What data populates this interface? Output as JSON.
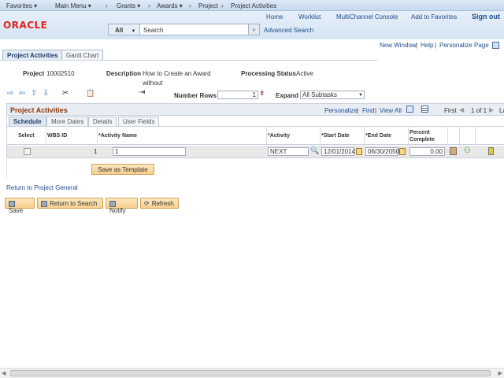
{
  "topnav": {
    "favorites": "Favorites ▾",
    "main_menu": "Main Menu ▾",
    "grants": "Grants ▾",
    "awards": "Awards ▾",
    "project": "Project",
    "project_activities": "Project Activities",
    "sep": "›"
  },
  "header": {
    "logo": "ORACLE",
    "links": [
      "Home",
      "Worklist",
      "MultiChannel Console",
      "Add to Favorites",
      "Sign out"
    ],
    "search_scope": "All",
    "search_placeholder": "Search",
    "advanced_search": "Advanced Search"
  },
  "pagelinks": {
    "new_window": "New Window",
    "help": "Help",
    "personalize_page": "Personalize Page"
  },
  "tabs": [
    "Project Activities",
    "Gantt Chart"
  ],
  "info": {
    "project_label": "Project",
    "project_value": "10002510",
    "description_label": "Description",
    "description_line1": "How to Create an Award",
    "description_line2": "without",
    "status_label": "Processing Status",
    "status_value": "Active"
  },
  "toolbar": {
    "number_rows_label": "Number Rows",
    "number_rows_value": "1",
    "expand_label": "Expand",
    "expand_value": "All Subtasks"
  },
  "grid": {
    "title": "Project Activities",
    "nav": {
      "personalize": "Personalize",
      "find": "Find",
      "view_all": "View All",
      "first": "First",
      "range": "1 of 1",
      "last": "La"
    },
    "tabs": [
      "Schedule",
      "More Dates",
      "Details",
      "User Fields"
    ],
    "columns": [
      "Select",
      "WBS ID",
      "*Activity Name",
      "*Activity",
      "*Start Date",
      "*End Date",
      "Percent Complete"
    ],
    "rows": [
      {
        "wbs_id": "1",
        "activity_name": "1",
        "activity": "NEXT",
        "start_date": "12/01/2014",
        "end_date": "06/30/2050",
        "percent_complete": "0.00"
      }
    ]
  },
  "save_as_template": "Save as Template",
  "return_link": "Return to Project General",
  "buttons": {
    "save": "Save",
    "return_to_search": "Return to Search",
    "notify": "Notify",
    "refresh": "Refresh"
  },
  "colors": {
    "oracle_red": "#e2231a",
    "link": "#1f4e8c",
    "section_title": "#8b3a0f",
    "button": "#f7cf8d"
  }
}
